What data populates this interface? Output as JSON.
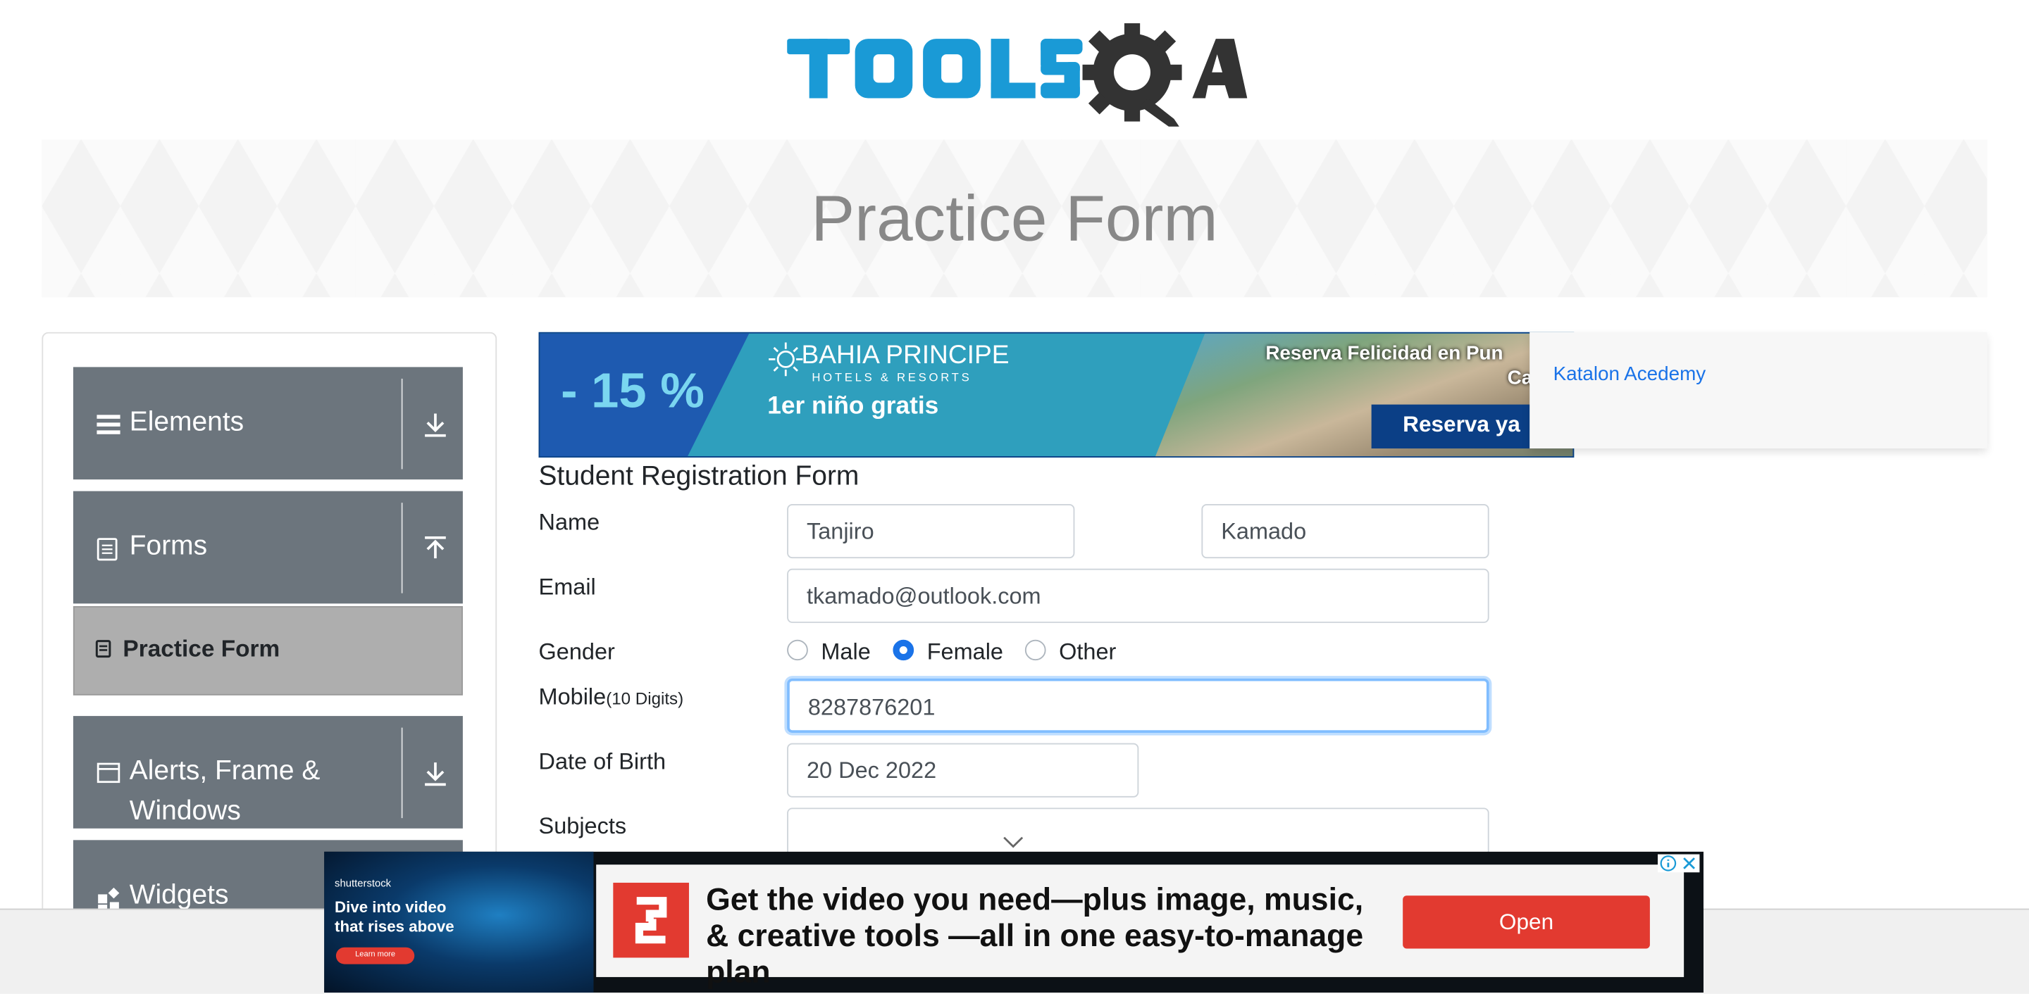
{
  "banner": {
    "title": "Practice Form"
  },
  "sidebar": {
    "groups": [
      {
        "label": "Elements",
        "icon": "hamburger-icon",
        "arrow": "download-arrow-icon"
      },
      {
        "label": "Forms",
        "icon": "document-icon",
        "arrow": "upload-arrow-icon"
      },
      {
        "label": "Alerts, Frame &",
        "label2": "Windows",
        "icon": "window-icon",
        "arrow": "download-arrow-icon"
      },
      {
        "label": "Widgets",
        "icon": "widgets-icon"
      }
    ],
    "active_item": "Practice Form"
  },
  "ads": {
    "top": {
      "discount": "- 15 %",
      "brand": "BAHIA PRINCIPE",
      "brand_sub": "HOTELS & RESORTS",
      "promo": "1er niño gratis",
      "headline": "Reserva Felicidad en Pun",
      "headline2": "Ca",
      "button": "Reserva ya"
    },
    "side_link": "Katalon Acedemy",
    "bottom": {
      "brand": "shutterstock",
      "tagline": "Dive into video that rises above",
      "learn": "Learn more",
      "headline": "Get the video you need—plus image, music, & creative tools —all in one easy-to-manage plan",
      "button": "Open"
    }
  },
  "form": {
    "title": "Student Registration Form",
    "name_label": "Name",
    "first_name": "Tanjiro",
    "last_name": "Kamado",
    "email_label": "Email",
    "email": "tkamado@outlook.com",
    "gender_label": "Gender",
    "gender_options": [
      "Male",
      "Female",
      "Other"
    ],
    "gender_selected": "Female",
    "mobile_label": "Mobile",
    "mobile_hint": "(10 Digits)",
    "mobile": "8287876201",
    "dob_label": "Date of Birth",
    "dob": "20 Dec 2022",
    "subjects_label": "Subjects"
  },
  "colors": {
    "accent": "#1a73e8",
    "sidebar": "#6c757d",
    "ad_red": "#e23a30"
  }
}
